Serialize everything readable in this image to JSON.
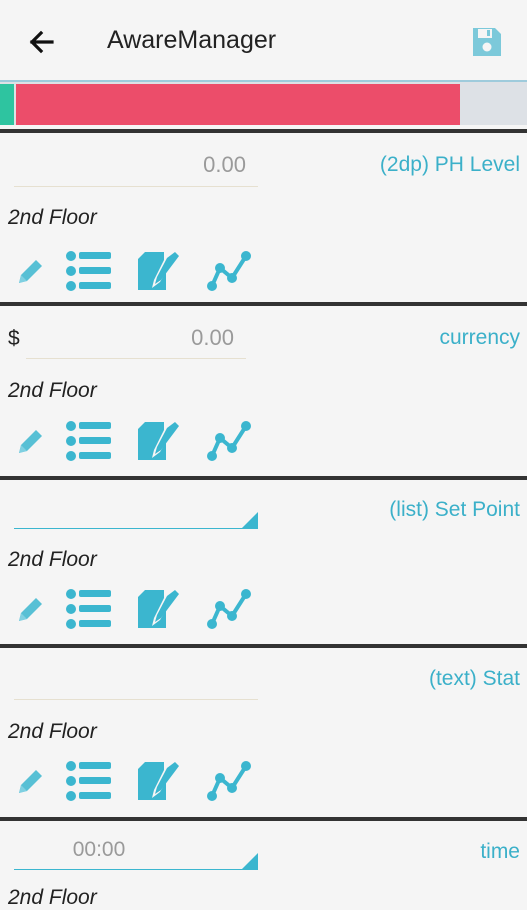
{
  "app": {
    "title": "AwareManager",
    "back_icon": "arrow-left-icon",
    "save_icon": "floppy-disk-icon",
    "accent": "#3bb6cf"
  },
  "progress": {
    "colors": {
      "green": "#2ec4a0",
      "red": "#ec4d6a",
      "track": "#dde1e6"
    }
  },
  "cards": [
    {
      "label": "(2dp) PH Level",
      "value": "0.00",
      "location": "2nd Floor"
    },
    {
      "label": "currency",
      "prefix": "$",
      "value": "0.00",
      "location": "2nd Floor"
    },
    {
      "label": "(list) Set Point",
      "value": "",
      "location": "2nd Floor"
    },
    {
      "label": "(text) Stat",
      "value": "",
      "location": "2nd Floor"
    },
    {
      "label": "time",
      "value": "00:00",
      "location": "2nd Floor"
    }
  ],
  "icons": [
    "pencil-icon",
    "list-icon",
    "edit-note-icon",
    "trend-chart-icon"
  ]
}
